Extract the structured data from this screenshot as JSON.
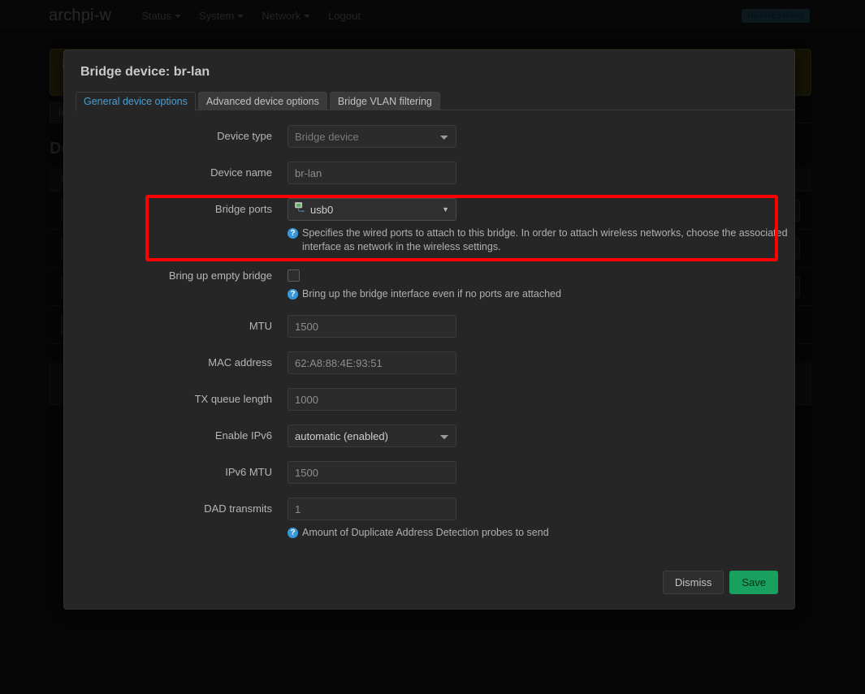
{
  "navbar": {
    "brand": "archpi-w",
    "links": [
      {
        "label": "Status",
        "has_caret": true
      },
      {
        "label": "System",
        "has_caret": true
      },
      {
        "label": "Network",
        "has_caret": true
      },
      {
        "label": "Logout",
        "has_caret": false
      }
    ],
    "status_badge": "REFRESHING"
  },
  "background": {
    "banner": {
      "title": "N",
      "subtitle": "Th"
    },
    "tab_label": "Int",
    "section_heading": "De",
    "table_header": "D",
    "rows": [
      {
        "icon": "network-device-icon",
        "actions": [
          "",
          ""
        ]
      },
      {
        "icon": "network-device-icon",
        "actions": [
          "",
          ""
        ]
      },
      {
        "icon": "wireless-device-icon",
        "actions": [
          "",
          ""
        ]
      }
    ],
    "add_button": ""
  },
  "modal": {
    "title": "Bridge device: br-lan",
    "tabs": [
      {
        "label": "General device options",
        "active": true
      },
      {
        "label": "Advanced device options",
        "active": false
      },
      {
        "label": "Bridge VLAN filtering",
        "active": false
      }
    ],
    "fields": {
      "device_type": {
        "label": "Device type",
        "value": "Bridge device",
        "disabled": true
      },
      "device_name": {
        "label": "Device name",
        "placeholder": "br-lan",
        "value": ""
      },
      "bridge_ports": {
        "label": "Bridge ports",
        "value": "usb0",
        "icon": "ethernet-device-icon",
        "arrow": "▼",
        "hint": "Specifies the wired ports to attach to this bridge. In order to attach wireless networks, choose the associated interface as network in the wireless settings."
      },
      "bring_up_empty_bridge": {
        "label": "Bring up empty bridge",
        "checked": false,
        "hint": "Bring up the bridge interface even if no ports are attached"
      },
      "mtu": {
        "label": "MTU",
        "placeholder": "1500",
        "value": ""
      },
      "mac_address": {
        "label": "MAC address",
        "placeholder": "62:A8:88:4E:93:51",
        "value": ""
      },
      "tx_queue_length": {
        "label": "TX queue length",
        "placeholder": "1000",
        "value": ""
      },
      "enable_ipv6": {
        "label": "Enable IPv6",
        "value": "automatic (enabled)",
        "disabled": false
      },
      "ipv6_mtu": {
        "label": "IPv6 MTU",
        "placeholder": "1500",
        "value": ""
      },
      "dad_transmits": {
        "label": "DAD transmits",
        "placeholder": "1",
        "value": "",
        "hint": "Amount of Duplicate Address Detection probes to send"
      }
    },
    "hint_marker": "?",
    "buttons": {
      "dismiss": "Dismiss",
      "save": "Save"
    }
  },
  "annotation": {
    "highlight_color": "#ff0000",
    "target": "bridge-ports-field"
  }
}
